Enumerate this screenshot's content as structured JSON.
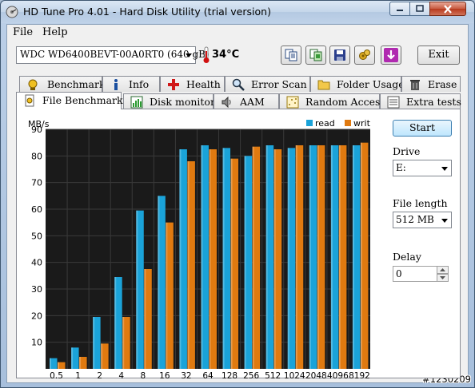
{
  "window": {
    "title": "HD Tune Pro 4.01 - Hard Disk Utility (trial version)"
  },
  "menu": {
    "file": "File",
    "help": "Help"
  },
  "toolbar": {
    "drive": "WDC WD6400BEVT-00A0RT0 (640 gB)",
    "temperature": "34°C",
    "exit_label": "Exit",
    "icons": [
      "copy-text-icon",
      "copy-screenshot-icon",
      "save-icon",
      "options-icon",
      "download-icon"
    ]
  },
  "tabs": {
    "row1": [
      {
        "label": "Benchmark",
        "icon": "benchmark-icon"
      },
      {
        "label": "Info",
        "icon": "info-icon"
      },
      {
        "label": "Health",
        "icon": "health-icon"
      },
      {
        "label": "Error Scan",
        "icon": "error-scan-icon"
      },
      {
        "label": "Folder Usage",
        "icon": "folder-icon"
      },
      {
        "label": "Erase",
        "icon": "erase-icon"
      }
    ],
    "row2": [
      {
        "label": "File Benchmark",
        "icon": "file-benchmark-icon",
        "active": true
      },
      {
        "label": "Disk monitor",
        "icon": "disk-monitor-icon"
      },
      {
        "label": "AAM",
        "icon": "speaker-icon"
      },
      {
        "label": "Random Access",
        "icon": "random-access-icon"
      },
      {
        "label": "Extra tests",
        "icon": "extra-tests-icon"
      }
    ]
  },
  "controls": {
    "start_label": "Start",
    "drive_label": "Drive",
    "drive_value": "E:",
    "file_length_label": "File length",
    "file_length_value": "512 MB",
    "delay_label": "Delay",
    "delay_value": "0"
  },
  "chart_data": {
    "type": "bar",
    "ylabel": "MB/s",
    "ylim": [
      0,
      90
    ],
    "yticks": [
      10,
      20,
      30,
      40,
      50,
      60,
      70,
      80,
      90
    ],
    "categories": [
      "0.5",
      "1",
      "2",
      "4",
      "8",
      "16",
      "32",
      "64",
      "128",
      "256",
      "512",
      "1024",
      "2048",
      "4096",
      "8192"
    ],
    "series": [
      {
        "name": "read",
        "color": "#1aa3d9",
        "values": [
          4,
          8,
          19.5,
          34.5,
          59.5,
          65,
          82.5,
          84,
          83,
          80,
          84,
          83,
          84,
          84,
          84
        ]
      },
      {
        "name": "write",
        "color": "#e07a10",
        "values": [
          2.5,
          4.5,
          9.5,
          19.5,
          37.5,
          55,
          78,
          82.5,
          79,
          83.5,
          82.5,
          84,
          84,
          84,
          85
        ]
      }
    ],
    "legend_position": "top-right",
    "background": "#1a1a1a",
    "grid": true
  },
  "watermark": "#1230209"
}
